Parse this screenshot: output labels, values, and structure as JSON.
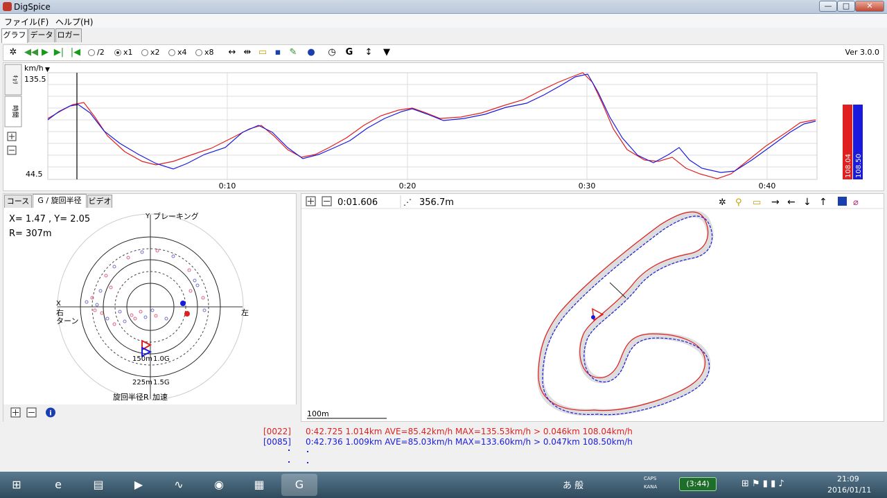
{
  "window": {
    "title": "DigSpice",
    "min_icon": "—",
    "max_icon": "□",
    "close_icon": "✕"
  },
  "menu": {
    "file": "ファイル(F)",
    "help": "ヘルプ(H)"
  },
  "tabs": [
    "グラフ",
    "データ",
    "ロガー"
  ],
  "toolbar": {
    "speeds": [
      "/2",
      "x1",
      "x2",
      "x4",
      "x8"
    ],
    "selected_speed": "x1",
    "g_label": "G",
    "version": "Ver 3.0.0"
  },
  "graph": {
    "unit": "km/h",
    "ymax": "135.5",
    "ymin": "44.5",
    "side_tabs": [
      "ｷｮﾘ",
      "時間"
    ],
    "time_ticks": [
      "0:10",
      "0:20",
      "0:30",
      "0:40"
    ],
    "red_value": "108.04",
    "blue_value": "108.50",
    "red_color": "#e02020",
    "blue_color": "#1a1adf"
  },
  "g_panel": {
    "tabs": [
      "コース",
      "G / 旋回半径",
      "ビデオ"
    ],
    "xy": "X=  1.47 , Y=  2.05",
    "r": "R= 307m",
    "axis_y": "Y",
    "braking": "ブレーキング",
    "x_label": "X",
    "right_turn": "右",
    "turn": "ターン",
    "left": "左",
    "ring1": "150m",
    "ring1g": "1.0G",
    "ring2": "225m",
    "ring2g": "1.5G",
    "bottom_left": "旋回半径R",
    "bottom_right": "加速"
  },
  "course": {
    "time": "0:01.606",
    "distance": "356.7m",
    "scale": "100m"
  },
  "laps": [
    {
      "id": "[0022]",
      "text": "0:42.725 1.014km AVE=85.42km/h MAX=135.53km/h > 0.046km 108.04km/h",
      "color": "#e02020"
    },
    {
      "id": "[0085]",
      "text": "0:42.736 1.009km AVE=85.03km/h MAX=133.60km/h > 0.047km 108.50km/h",
      "color": "#1a1adf"
    }
  ],
  "taskbar": {
    "ime": "あ 般",
    "caps": "CAPS",
    "kana": "KANA",
    "battery": "(3:44)",
    "time": "21:09",
    "date": "2016/01/11"
  }
}
